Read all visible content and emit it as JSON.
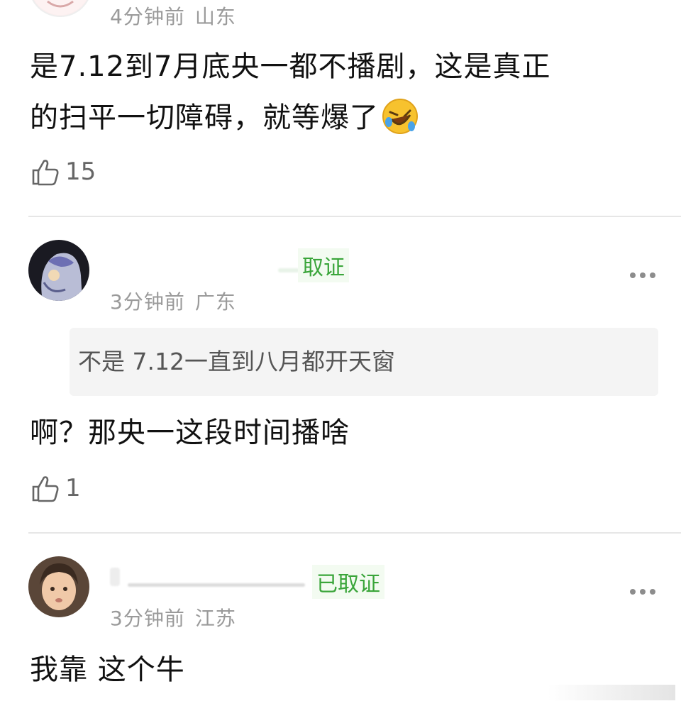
{
  "comments": [
    {
      "time": "4分钟前",
      "location": "山东",
      "text_line1": "是7.12到7月底央一都不播剧，这是真正",
      "text_line2": "的扫平一切障碍，就等爆了",
      "emoji": "rolling-on-floor-laughing-emoji",
      "likes": "15"
    },
    {
      "badge": "取证",
      "time": "3分钟前",
      "location": "广东",
      "quote": "不是 7.12一直到八月都开天窗",
      "text": "啊？那央一这段时间播啥",
      "likes": "1"
    },
    {
      "badge": "已取证",
      "time": "3分钟前",
      "location": "江苏",
      "text": "我靠 这个牛"
    }
  ],
  "colors": {
    "badge_green": "#3aa53a",
    "meta_gray": "#9a9a9a",
    "divider": "#e6e6e6",
    "quote_bg": "#f4f4f4"
  }
}
